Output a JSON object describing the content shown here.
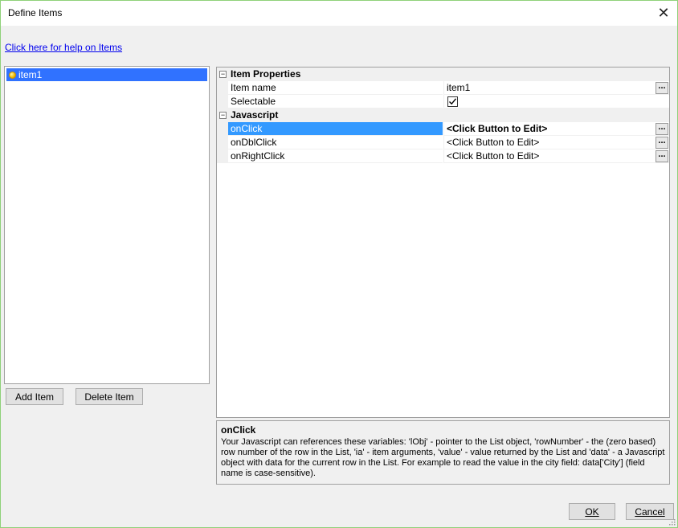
{
  "window": {
    "title": "Define Items",
    "close_glyph": "✕"
  },
  "help_link": "Click here for help on Items",
  "item_list": {
    "items": [
      {
        "label": "item1",
        "selected": true
      }
    ]
  },
  "buttons": {
    "add_item": "Add Item",
    "delete_item": "Delete Item",
    "ok": "OK",
    "cancel": "Cancel"
  },
  "property_grid": {
    "categories": [
      {
        "label": "Item Properties",
        "toggle": "−",
        "properties": [
          {
            "name": "Item name",
            "value": "item1",
            "has_button": true
          },
          {
            "name": "Selectable",
            "value_type": "checkbox",
            "checked": true
          }
        ]
      },
      {
        "label": "Javascript",
        "toggle": "−",
        "properties": [
          {
            "name": "onClick",
            "value": "<Click Button to Edit>",
            "has_button": true,
            "selected": true
          },
          {
            "name": "onDblClick",
            "value": "<Click Button to Edit>",
            "has_button": true
          },
          {
            "name": "onRightClick",
            "value": "<Click Button to Edit>",
            "has_button": true
          }
        ]
      }
    ],
    "ellipsis_label": "..."
  },
  "description": {
    "title": "onClick",
    "text": "Your Javascript can references these variables: 'lObj' - pointer to the List object, 'rowNumber' - the (zero based) row number of the row in the List, 'ia' - item arguments, 'value'  - value returned by the List and 'data' - a Javascript object with data for the current row in the List. For example to read the value in the city field: data['City'] (field name is case-sensitive)."
  },
  "colors": {
    "selection": "#3399ff",
    "list_selection": "#3072ff",
    "link": "#0000ee"
  }
}
